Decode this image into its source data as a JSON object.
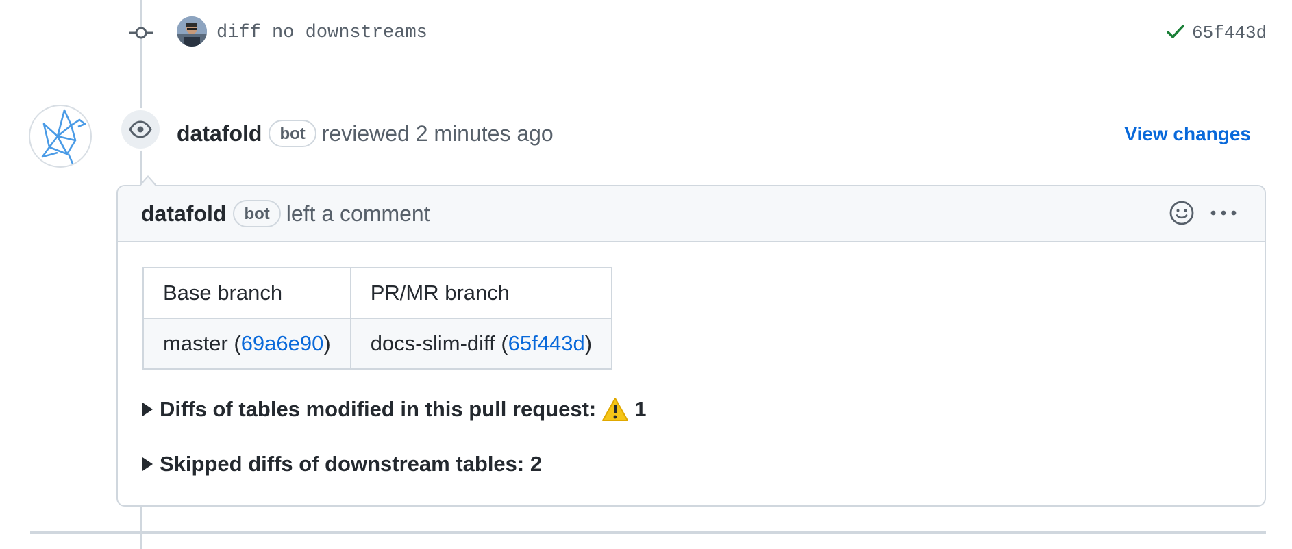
{
  "commit": {
    "message": "diff no downstreams",
    "sha": "65f443d",
    "status_icon": "check-icon",
    "status_color": "#1a7f37"
  },
  "review": {
    "actor": "datafold",
    "badge": "bot",
    "action": "reviewed 2 minutes ago",
    "view_changes_label": "View changes",
    "event_icon": "eye-icon"
  },
  "comment": {
    "actor": "datafold",
    "badge": "bot",
    "action": "left a comment",
    "table": {
      "headers": [
        "Base branch",
        "PR/MR branch"
      ],
      "base": {
        "branch": "master",
        "sha": "69a6e90"
      },
      "pr": {
        "branch": "docs-slim-diff",
        "sha": "65f443d"
      }
    },
    "details": [
      {
        "label": "Diffs of tables modified in this pull request:",
        "icon": "warning-icon",
        "count": "1"
      },
      {
        "label": "Skipped diffs of downstream tables:",
        "count": "2"
      }
    ]
  },
  "colors": {
    "link": "#0969da",
    "border": "#d0d7de",
    "muted": "#57606a",
    "header_bg": "#f6f8fa"
  }
}
